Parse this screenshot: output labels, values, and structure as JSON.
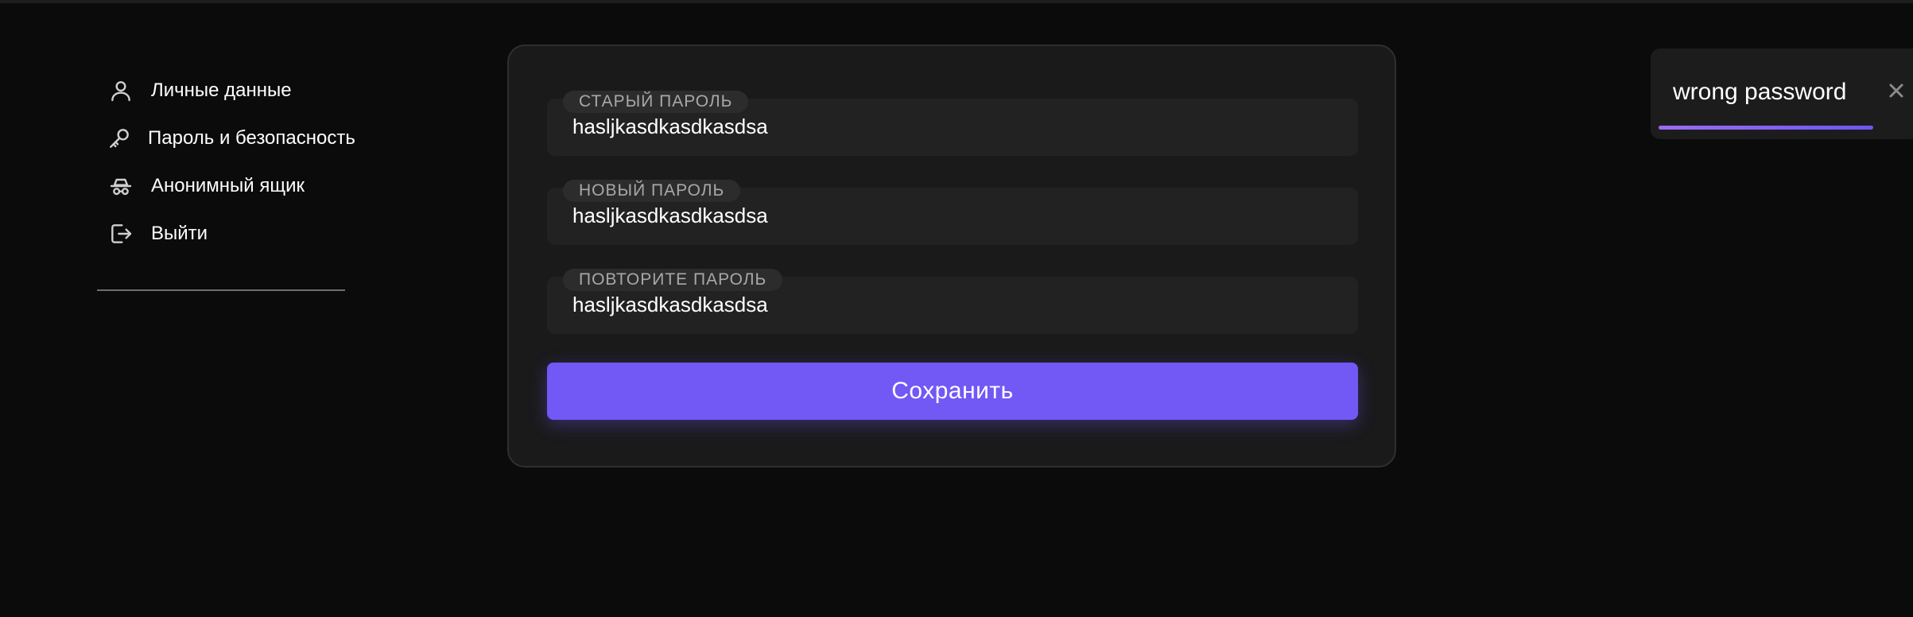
{
  "sidebar": {
    "items": [
      {
        "label": "Личные данные",
        "icon": "user-icon"
      },
      {
        "label": "Пароль и безопасность",
        "icon": "key-icon"
      },
      {
        "label": "Анонимный ящик",
        "icon": "incognito-icon"
      },
      {
        "label": "Выйти",
        "icon": "logout-icon"
      }
    ]
  },
  "form": {
    "fields": [
      {
        "label": "СТАРЫЙ ПАРОЛЬ",
        "value": "hasljkasdkasdkasdsa"
      },
      {
        "label": "НОВЫЙ ПАРОЛЬ",
        "value": "hasljkasdkasdkasdsa"
      },
      {
        "label": "ПОВТОРИТЕ ПАРОЛЬ",
        "value": "hasljkasdkasdkasdsa"
      }
    ],
    "save_label": "Сохранить"
  },
  "toast": {
    "message": "wrong password",
    "close_icon": "close-icon"
  },
  "colors": {
    "background": "#0b0b0b",
    "card": "#1a1a1b",
    "accent": "#7258f5",
    "text": "#ffffff",
    "muted": "#a8a8a8"
  }
}
